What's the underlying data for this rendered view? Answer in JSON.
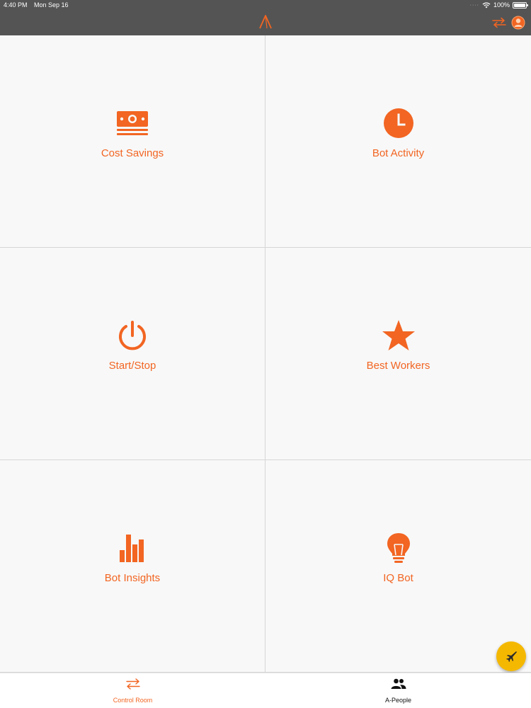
{
  "status_bar": {
    "time": "4:40 PM",
    "date": "Mon Sep 16",
    "battery": "100%"
  },
  "nav": {
    "logo_icon": "a-logo-icon",
    "switch_icon": "arrows-swap-icon",
    "profile_icon": "user-profile-icon"
  },
  "tiles": [
    {
      "label": "Cost Savings",
      "icon": "money-stack-icon"
    },
    {
      "label": "Bot Activity",
      "icon": "clock-icon"
    },
    {
      "label": "Start/Stop",
      "icon": "power-icon"
    },
    {
      "label": "Best Workers",
      "icon": "star-icon"
    },
    {
      "label": "Bot Insights",
      "icon": "bar-chart-icon"
    },
    {
      "label": "IQ Bot",
      "icon": "lightbulb-icon"
    }
  ],
  "tabs": [
    {
      "label": "Control Room",
      "icon": "arrows-swap-icon",
      "active": true
    },
    {
      "label": "A-People",
      "icon": "people-icon",
      "active": false
    }
  ],
  "fab": {
    "icon": "bot-jet-icon"
  },
  "colors": {
    "accent": "#f26522",
    "header_bg": "#545454",
    "fab_bg": "#f5b800"
  }
}
